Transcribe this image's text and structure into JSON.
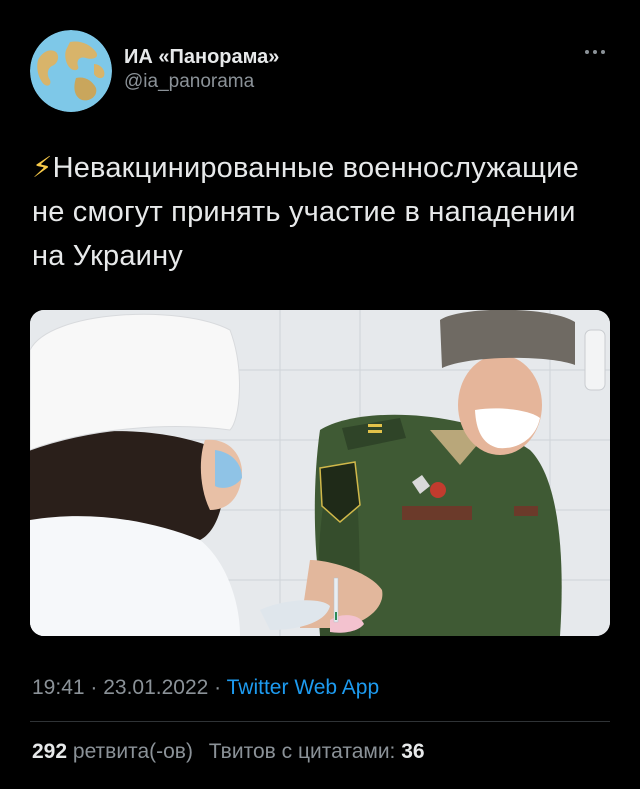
{
  "author": {
    "display_name": "ИА «Панорама»",
    "handle": "@ia_panorama"
  },
  "more_icon": "more-horizontal-icon",
  "tweet": {
    "bolt": "⚡",
    "text": "Невакцинированные военнослужащие не смогут принять участие в нападении на Украину"
  },
  "meta": {
    "time": "19:41",
    "sep1": " · ",
    "date": "23.01.2022",
    "sep2": " · ",
    "app": "Twitter Web App"
  },
  "stats": {
    "retweets_count": "292",
    "retweets_label": "ретвита(-ов)",
    "quotes_label": "Твитов с цитатами:",
    "quotes_count": "36"
  },
  "colors": {
    "background": "#000000",
    "text": "#e7e9ea",
    "secondary": "#8b9298",
    "link": "#1d9bf0"
  }
}
